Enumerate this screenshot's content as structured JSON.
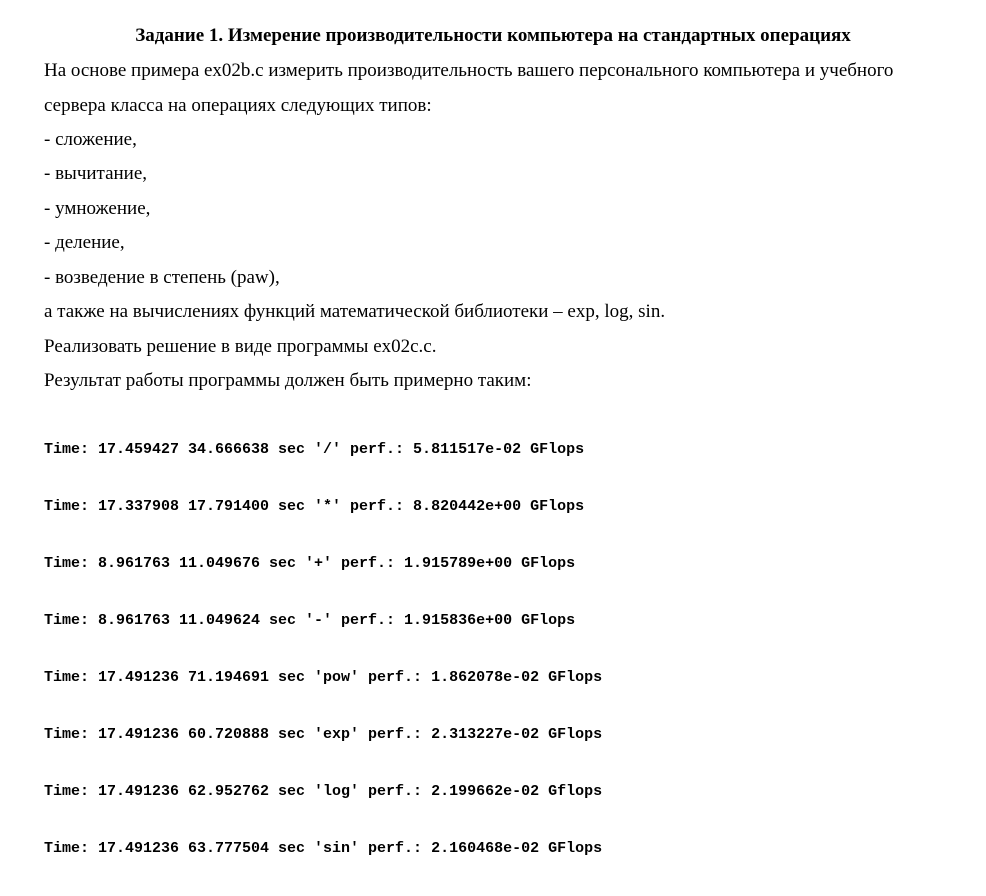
{
  "document": {
    "title": "Задание 1. Измерение производительности компьютера на стандартных операциях",
    "paragraphs": [
      "На основе примера ex02b.c измерить производительность вашего персонального компьютера и учебного",
      "сервера класса на операциях следующих типов:",
      "- сложение,",
      "- вычитание,",
      "- умножение,",
      "- деление,",
      "- возведение в степень (paw),",
      "а также на вычислениях функций математической библиотеки – exp, log, sin.",
      "Реализовать решение в виде программы ex02c.c.",
      "Результат работы программы должен быть примерно таким:"
    ],
    "output_lines": [
      "Time: 17.459427 34.666638 sec '/' perf.: 5.811517e-02 GFlops",
      "Time: 17.337908 17.791400 sec '*' perf.: 8.820442e+00 GFlops",
      "Time: 8.961763 11.049676 sec '+' perf.: 1.915789e+00 GFlops",
      "Time: 8.961763 11.049624 sec '-' perf.: 1.915836e+00 GFlops",
      "Time: 17.491236 71.194691 sec 'pow' perf.: 1.862078e-02 GFlops",
      "Time: 17.491236 60.720888 sec 'exp' perf.: 2.313227e-02 GFlops",
      "Time: 17.491236 62.952762 sec 'log' perf.: 2.199662e-02 Gflops",
      "Time: 17.491236 63.777504 sec 'sin' perf.: 2.160468e-02 GFlops"
    ]
  }
}
